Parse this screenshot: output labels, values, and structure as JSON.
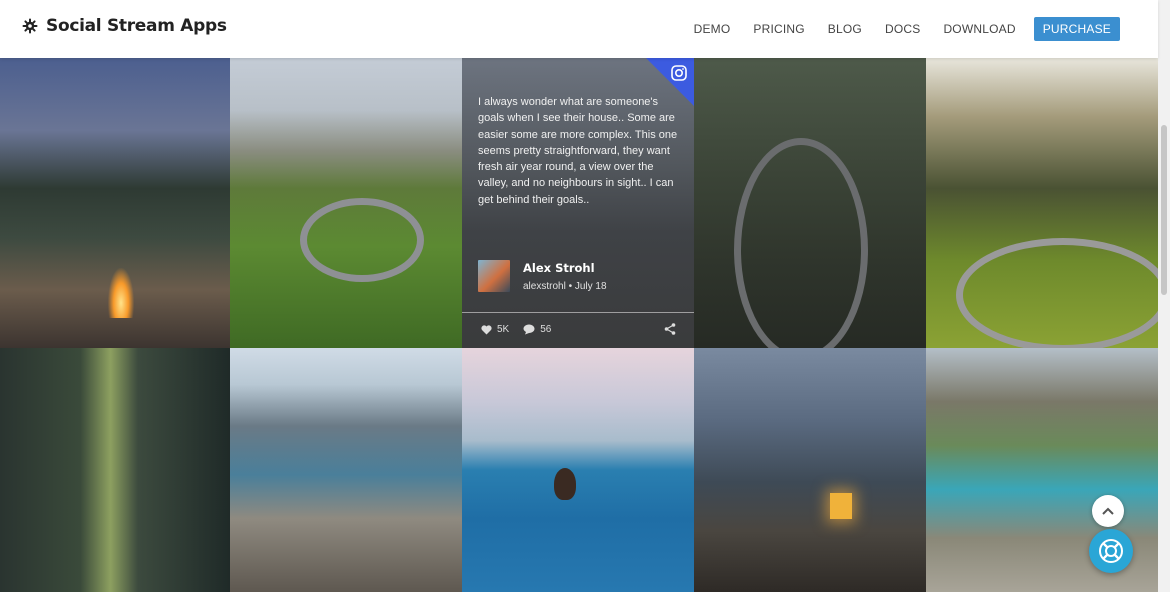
{
  "header": {
    "logo_text": "Social Stream Apps",
    "nav": [
      "DEMO",
      "PRICING",
      "BLOG",
      "DOCS",
      "DOWNLOAD"
    ],
    "purchase_label": "PURCHASE"
  },
  "featured_post": {
    "text": "I always wonder what are someone's goals when I see their house.. Some are easier some are more complex. This one seems pretty straightforward, they want fresh air year round, a view over the valley, and no neighbours in sight.. I can get behind their goals..",
    "author_name": "Alex Strohl",
    "author_handle": "alexstrohl",
    "date": "July 18",
    "likes": "5K",
    "comments": "56",
    "network_icon": "instagram-icon"
  },
  "colors": {
    "accent": "#3b8fd0",
    "instagram_corner": "#3c5be0",
    "help_button": "#2aa6d6"
  },
  "icons": [
    "gear-logo-icon",
    "instagram-icon",
    "heart-icon",
    "comment-icon",
    "share-icon",
    "chevron-up-icon",
    "lifebuoy-icon"
  ]
}
